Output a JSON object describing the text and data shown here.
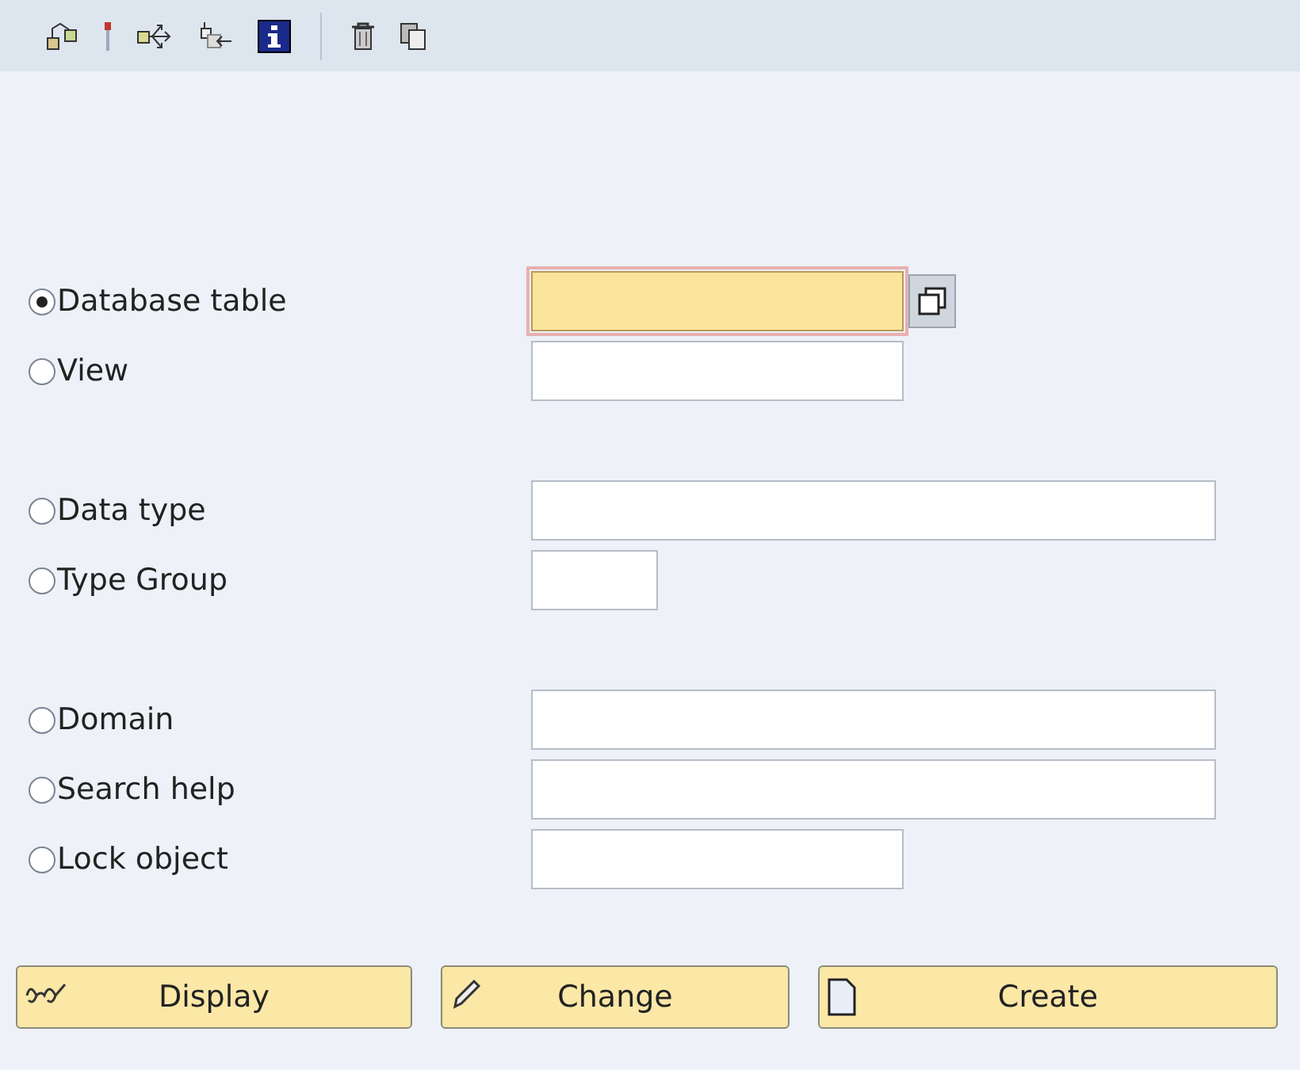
{
  "toolbar": [
    {
      "kind": "hierarchy"
    },
    {
      "kind": "marker"
    },
    {
      "kind": "branch"
    },
    {
      "kind": "insert"
    },
    {
      "kind": "info"
    },
    {
      "kind": "separator"
    },
    {
      "kind": "trash"
    },
    {
      "kind": "copy"
    }
  ],
  "option_groups": [
    [
      {
        "label": "Database table",
        "selected": true,
        "focused": true
      },
      {
        "label": "View",
        "selected": false,
        "focused": false
      }
    ],
    [
      {
        "label": "Data type",
        "selected": false,
        "focused": false
      },
      {
        "label": "Type Group",
        "selected": false,
        "focused": false
      }
    ],
    [
      {
        "label": "Domain",
        "selected": false,
        "focused": false
      },
      {
        "label": "Search help",
        "selected": false,
        "focused": false
      },
      {
        "label": "Lock object",
        "selected": false,
        "focused": false
      }
    ]
  ],
  "buttons": [
    {
      "label": "Display",
      "kind": "glasses"
    },
    {
      "label": "Change",
      "kind": "pencil"
    },
    {
      "label": "Create",
      "kind": "page"
    }
  ]
}
